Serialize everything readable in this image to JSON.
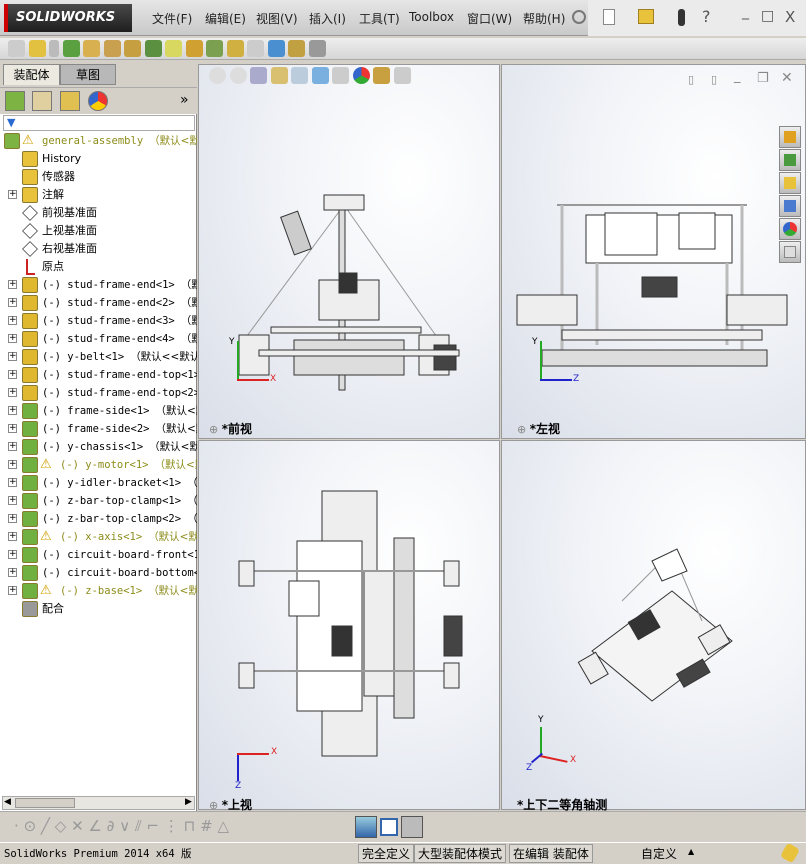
{
  "app": {
    "logo": "SOLIDWORKS",
    "brand_color": "#cc0000"
  },
  "menu": [
    "文件(F)",
    "编辑(E)",
    "视图(V)",
    "插入(I)",
    "工具(T)",
    "Toolbox",
    "窗口(W)",
    "帮助(H)"
  ],
  "window_controls": {
    "help": "?",
    "minimize": "_",
    "restore": "□",
    "close": "X"
  },
  "left_panel": {
    "tabs": [
      "装配体",
      "草图"
    ],
    "active_tab": "装配体",
    "expand_label": "»",
    "tree": [
      {
        "label": "general-assembly",
        "suffix": "（默认<默",
        "warning": true,
        "expandable": false,
        "icon": "assembly-icon"
      },
      {
        "label": "History",
        "icon": "history-icon",
        "expandable": false
      },
      {
        "label": "传感器",
        "icon": "sensor-icon",
        "expandable": false
      },
      {
        "label": "注解",
        "icon": "annotation-icon",
        "expandable": true
      },
      {
        "label": "前视基准面",
        "icon": "plane-icon",
        "expandable": false
      },
      {
        "label": "上视基准面",
        "icon": "plane-icon",
        "expandable": false
      },
      {
        "label": "右视基准面",
        "icon": "plane-icon",
        "expandable": false
      },
      {
        "label": "原点",
        "icon": "origin-icon",
        "expandable": false
      },
      {
        "label": "(-) stud-frame-end<1>",
        "suffix": "（默认",
        "icon": "part-icon",
        "expandable": true
      },
      {
        "label": "(-) stud-frame-end<2>",
        "suffix": "（默认",
        "icon": "part-icon",
        "expandable": true
      },
      {
        "label": "(-) stud-frame-end<3>",
        "suffix": "（默认",
        "icon": "part-icon",
        "expandable": true
      },
      {
        "label": "(-) stud-frame-end<4>",
        "suffix": "（默认",
        "icon": "part-icon",
        "expandable": true
      },
      {
        "label": "(-) y-belt<1>",
        "suffix": "（默认<<默认>",
        "icon": "part-icon",
        "expandable": true
      },
      {
        "label": "(-) stud-frame-end-top<1>",
        "suffix": "",
        "icon": "part-icon",
        "expandable": true
      },
      {
        "label": "(-) stud-frame-end-top<2>",
        "suffix": "",
        "icon": "part-icon",
        "expandable": true
      },
      {
        "label": "(-) frame-side<1>",
        "suffix": "（默认<默",
        "icon": "subassembly-icon",
        "expandable": true
      },
      {
        "label": "(-) frame-side<2>",
        "suffix": "（默认<默",
        "icon": "subassembly-icon",
        "expandable": true
      },
      {
        "label": "(-) y-chassis<1>",
        "suffix": "（默认<默",
        "icon": "subassembly-icon",
        "expandable": true
      },
      {
        "label": "(-) y-motor<1>",
        "suffix": "（默认<默",
        "warning": true,
        "icon": "subassembly-icon",
        "expandable": true
      },
      {
        "label": "(-) y-idler-bracket<1>",
        "suffix": "（默",
        "icon": "subassembly-icon",
        "expandable": true
      },
      {
        "label": "(-) z-bar-top-clamp<1>",
        "suffix": "（默",
        "icon": "subassembly-icon",
        "expandable": true
      },
      {
        "label": "(-) z-bar-top-clamp<2>",
        "suffix": "（默",
        "icon": "subassembly-icon",
        "expandable": true
      },
      {
        "label": "(-) x-axis<1>",
        "suffix": "（默认<默",
        "warning": true,
        "icon": "subassembly-icon",
        "expandable": true
      },
      {
        "label": "(-) circuit-board-front<1>",
        "suffix": "",
        "icon": "subassembly-icon",
        "expandable": true
      },
      {
        "label": "(-) circuit-board-bottom<",
        "suffix": "",
        "icon": "subassembly-icon",
        "expandable": true
      },
      {
        "label": "(-) z-base<1>",
        "suffix": "（默认<默",
        "warning": true,
        "icon": "subassembly-icon",
        "expandable": true
      },
      {
        "label": "配合",
        "icon": "mates-icon",
        "expandable": false
      }
    ]
  },
  "viewports": [
    {
      "label": "*前视",
      "triad": [
        "Y",
        "X"
      ]
    },
    {
      "label": "*左视",
      "triad": [
        "Y",
        "Z"
      ]
    },
    {
      "label": "*上视",
      "triad": [
        "X",
        "Z"
      ]
    },
    {
      "label": "*上下二等角轴测",
      "triad": [
        "Y",
        "X",
        "Z"
      ]
    }
  ],
  "status_bar": {
    "product": "SolidWorks Premium 2014 x64 版",
    "fields": [
      "完全定义",
      "大型装配体模式",
      "在编辑 装配体"
    ],
    "units": "自定义",
    "units_arrow": "▲"
  }
}
